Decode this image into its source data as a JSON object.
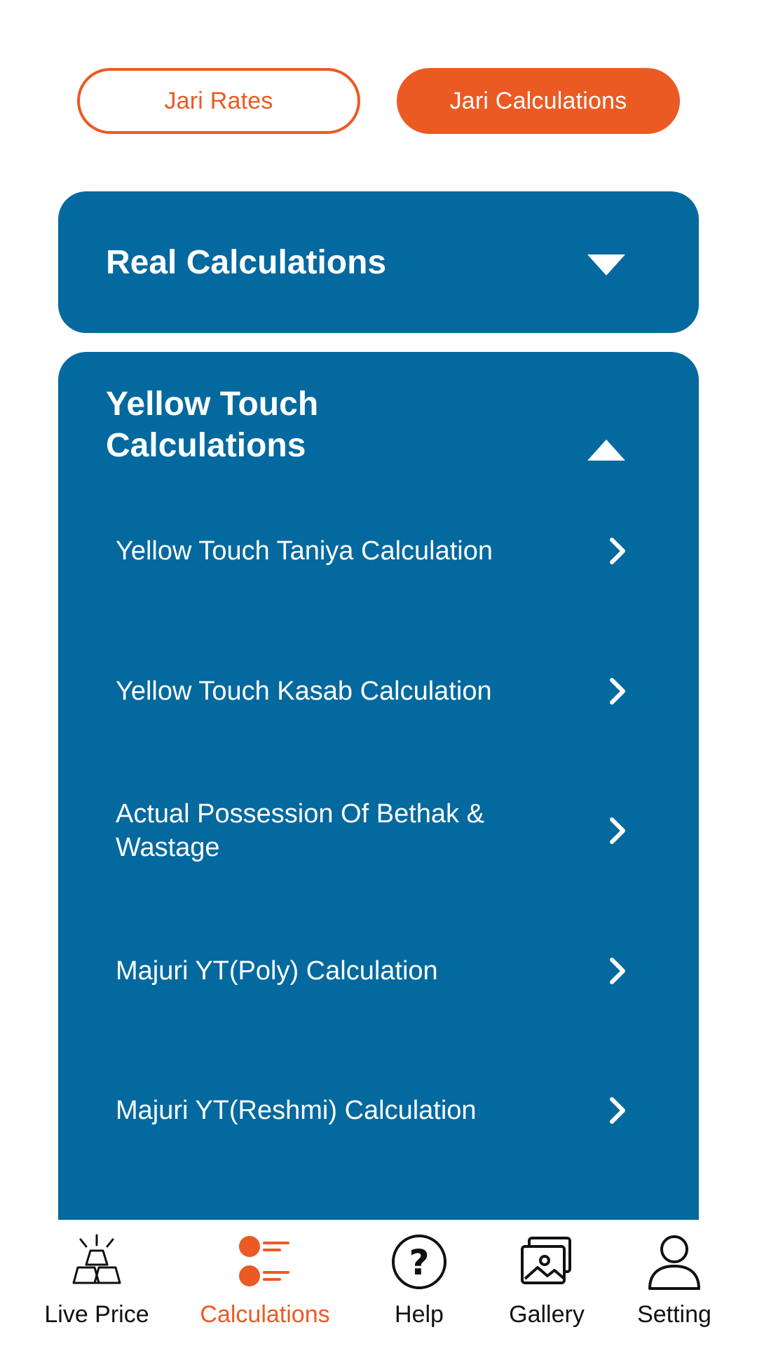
{
  "top_tabs": {
    "rates_label": "Jari Rates",
    "calculations_label": "Jari Calculations"
  },
  "sections": {
    "real": {
      "title": "Real Calculations"
    },
    "yellow_touch": {
      "title_line1": "Yellow Touch",
      "title_line2": "Calculations",
      "items": [
        {
          "label": "Yellow Touch Taniya Calculation"
        },
        {
          "label": "Yellow Touch Kasab Calculation"
        },
        {
          "label": "Actual Possession Of Bethak & Wastage"
        },
        {
          "label": "Majuri YT(Poly) Calculation"
        },
        {
          "label": "Majuri YT(Reshmi) Calculation"
        }
      ]
    }
  },
  "bottom_nav": {
    "items": [
      {
        "label": "Live Price",
        "icon": "gold-bars-icon"
      },
      {
        "label": "Calculations",
        "icon": "calculations-list-icon",
        "active": true
      },
      {
        "label": "Help",
        "icon": "help-icon"
      },
      {
        "label": "Gallery",
        "icon": "gallery-icon"
      },
      {
        "label": "Setting",
        "icon": "user-icon"
      }
    ]
  },
  "colors": {
    "accent": "#EB5A23",
    "card_blue": "#03699E",
    "background": "#FFFFFF"
  }
}
